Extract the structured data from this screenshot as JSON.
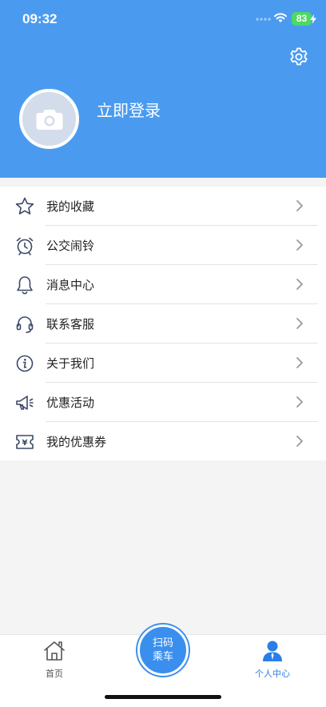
{
  "status_bar": {
    "time": "09:32",
    "battery": "83",
    "battery_color": "#4cd964"
  },
  "header": {
    "background": "#4a9bf0",
    "login_label": "立即登录",
    "settings_icon": "gear-icon",
    "avatar_icon": "camera-icon"
  },
  "menu": {
    "items": [
      {
        "label": "我的收藏",
        "icon": "star-icon"
      },
      {
        "label": "公交闹铃",
        "icon": "alarm-clock-icon"
      },
      {
        "label": "消息中心",
        "icon": "bell-icon"
      },
      {
        "label": "联系客服",
        "icon": "headset-icon"
      },
      {
        "label": "关于我们",
        "icon": "info-icon"
      },
      {
        "label": "优惠活动",
        "icon": "megaphone-icon"
      },
      {
        "label": "我的优惠券",
        "icon": "coupon-icon"
      }
    ]
  },
  "tabbar": {
    "home_label": "首页",
    "scan_line1": "扫码",
    "scan_line2": "乘车",
    "profile_label": "个人中心",
    "active_color": "#2a7ee6"
  }
}
